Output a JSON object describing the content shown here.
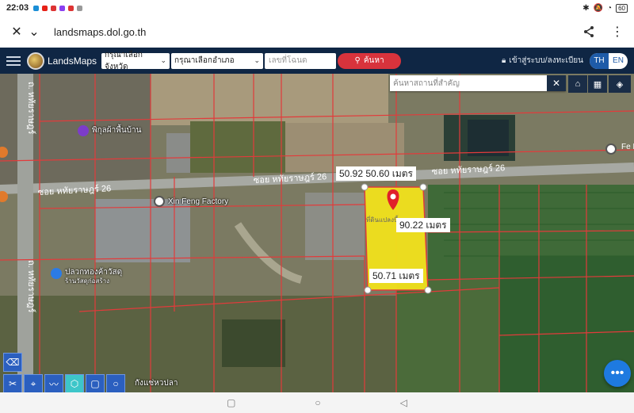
{
  "status_bar": {
    "time": "22:03",
    "battery": "60",
    "notification_icons": [
      "app-icon",
      "youtube-icon",
      "gmail-icon",
      "messenger-icon",
      "gmail-icon",
      "chrome-icon"
    ],
    "right_icons": [
      "bluetooth-icon",
      "silent-icon",
      "wifi-icon",
      "battery-icon"
    ]
  },
  "browser": {
    "url": "landsmaps.dol.go.th",
    "close_icon": "✕",
    "chevron_icon": "⌄",
    "share_icon": "⋖",
    "menu_icon": "⋮"
  },
  "header": {
    "brand": "LandsMaps",
    "province_placeholder": "กรุณาเลือกจังหวัด",
    "district_placeholder": "กรุณาเลือกอำเภอ",
    "deed_placeholder": "เลขที่โฉนด",
    "search_label": "ค้นหา",
    "login_label": "เข้าสู่ระบบ/ลงทะเบียน",
    "lang_th": "TH",
    "lang_en": "EN"
  },
  "map": {
    "place_search_placeholder": "ค้นหาสถานที่สำคัญ",
    "measurements": {
      "top": "50.92 50.60 เมตร",
      "right": "90.22 เมตร",
      "bottom": "50.71 เมตร"
    },
    "pois": {
      "shop": "พิกุลผ้าพื้นบ้าน",
      "factory": "Xin Feng Factory",
      "hardware": "ปลวกทองค้าวัสดุ",
      "hardware_sub": "ร้านวัสดุก่อสร้าง",
      "bottom": "กังแซ่หวปลา"
    },
    "roads": {
      "soi_upper": "ซอย หทัยราษฎร์ 26",
      "soi_lower": "ซอย หทัยราษฎร์ 26",
      "soi_mid": "ซอย หทัยราษฎร์ 26",
      "main_road_1": "ถ. หทัยราษฎร์",
      "main_road_2": "ถ. หทัยราษฎร์",
      "edge_label": "Fe Li"
    },
    "parcel_label": "ที่ดินแปลงนี้",
    "colors": {
      "parcel_fill": "#f2e21c",
      "parcel_line": "#e23b3b",
      "pin": "#e0202a"
    }
  },
  "sysnav": {
    "recent": "▢",
    "home": "○",
    "back": "◁"
  }
}
